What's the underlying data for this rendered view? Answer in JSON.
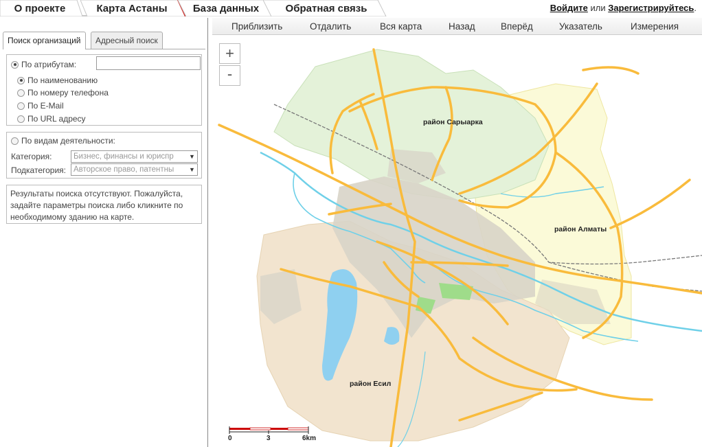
{
  "nav": {
    "tabs": [
      "О проекте",
      "Карта Астаны",
      "База данных",
      "Обратная связь"
    ],
    "active_tab": "Карта Астаны",
    "login": "Войдите",
    "or": "или",
    "register": "Зарегистрируйтесь",
    "dot": "."
  },
  "search": {
    "tabs": [
      "Поиск организаций",
      "Адресный поиск"
    ],
    "by_attributes": "По атрибутам:",
    "attribute_input_value": "",
    "options": [
      "По наименованию",
      "По номеру телефона",
      "По E-Mail",
      "По URL адресу"
    ],
    "by_activity": "По видам деятельности:",
    "category_label": "Категория:",
    "category_value": "Бизнес, финансы и юриспр",
    "subcategory_label": "Подкатегория:",
    "subcategory_value": "Авторское право, патентны",
    "no_results": "Результаты поиска отсутствуют. Пожалуйста, задайте параметры поиска либо кликните по необходимому зданию на карте."
  },
  "toolbar": {
    "zoom_in": "Приблизить",
    "zoom_out": "Отдалить",
    "full_map": "Вся карта",
    "back": "Назад",
    "forward": "Вперёд",
    "pointer": "Указатель",
    "measure": "Измерения"
  },
  "map": {
    "zoom_in_symbol": "+",
    "zoom_out_symbol": "-",
    "districts": [
      "район Сарыарка",
      "район Алматы",
      "район Есил"
    ],
    "scale_labels": [
      "0",
      "3",
      "6km"
    ],
    "colors": {
      "saryarka_fill": "#e4f2d9",
      "almaty_fill": "#fbfad8",
      "esil_fill": "#f2e4cf",
      "river": "#6fd0e8",
      "roads": "#f9bb3c",
      "lake": "#8fd0f0",
      "urban": "#d8d4c8"
    }
  }
}
